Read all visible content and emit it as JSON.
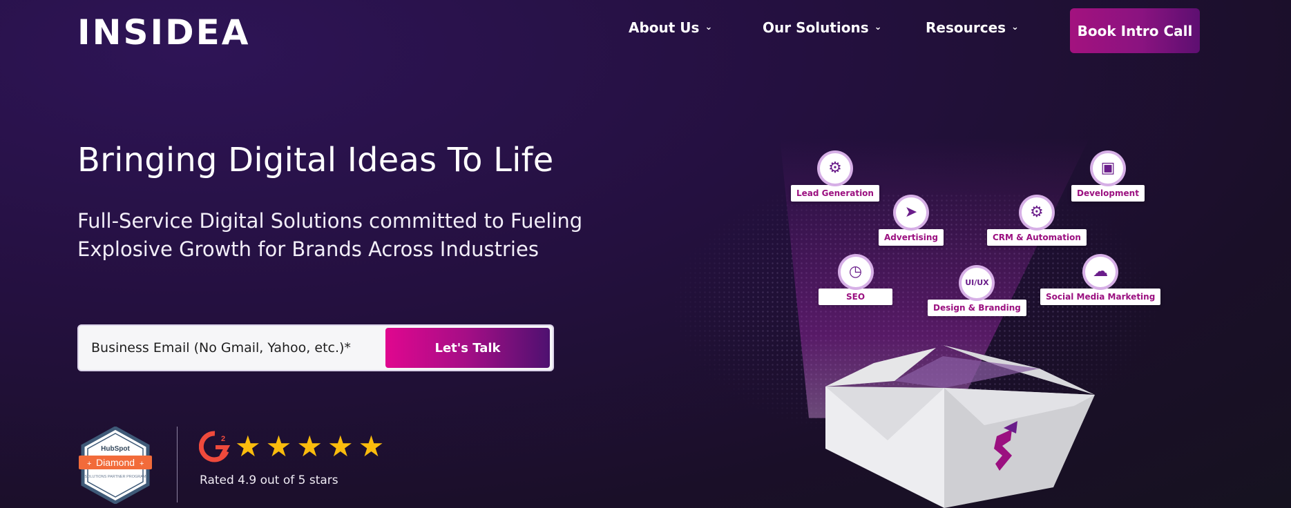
{
  "header": {
    "logo_text": "INSIDEA",
    "nav": [
      {
        "label": "About Us"
      },
      {
        "label": "Our Solutions"
      },
      {
        "label": "Resources"
      }
    ],
    "cta_label": "Book Intro Call"
  },
  "hero": {
    "title": "Bringing Digital Ideas To Life",
    "subtitle_line1": "Full-Service Digital Solutions committed to Fueling",
    "subtitle_line2": "Explosive Growth for Brands Across Industries",
    "email_placeholder": "Business Email (No Gmail, Yahoo, etc.)*",
    "submit_label": "Let's Talk"
  },
  "badges": {
    "hubspot_brand": "HubSpot",
    "hubspot_tier": "Diamond",
    "hubspot_program": "SOLUTIONS PARTNER PROGRAM",
    "g2_logo": "G2",
    "rating_stars": 5,
    "rating_text": "Rated 4.9 out of 5 stars"
  },
  "illustration": {
    "services": [
      {
        "label": "Lead Generation",
        "icon": "monitor-gear-icon"
      },
      {
        "label": "Development",
        "icon": "browser-window-icon"
      },
      {
        "label": "Advertising",
        "icon": "megaphone-icon"
      },
      {
        "label": "CRM & Automation",
        "icon": "gears-icon"
      },
      {
        "label": "SEO",
        "icon": "analytics-icon"
      },
      {
        "label": "Design & Branding",
        "icon": "ui-ux-icon"
      },
      {
        "label": "Social Media Marketing",
        "icon": "network-icon"
      }
    ]
  },
  "colors": {
    "background": "#24103f",
    "accent_pink": "#e0078f",
    "accent_purple": "#4e1170",
    "star": "#fbbc0d",
    "label_text": "#9b1080"
  }
}
